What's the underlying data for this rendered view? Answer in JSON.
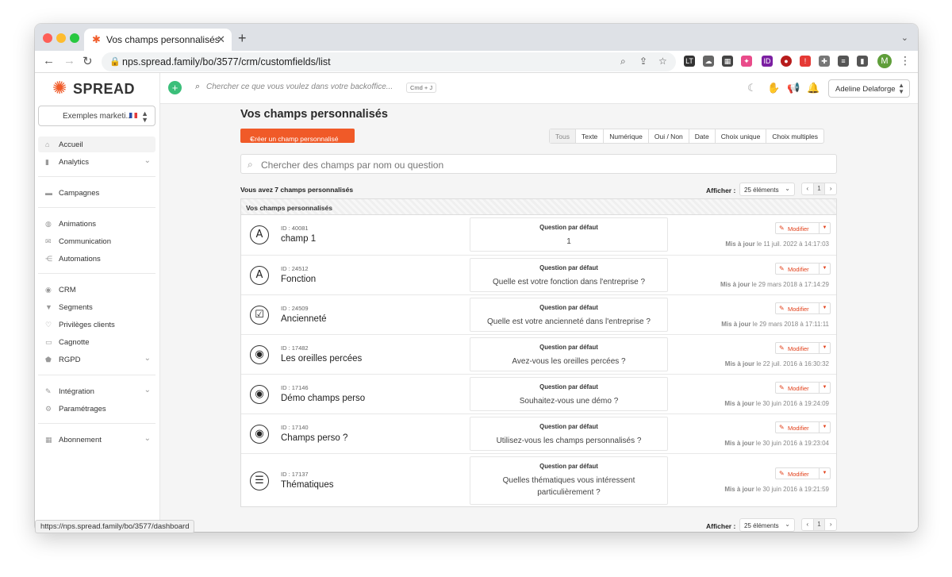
{
  "browser": {
    "tab_title": "Vos champs personnalisés",
    "url": "nps.spread.family/bo/3577/crm/customfields/list",
    "status_url": "https://nps.spread.family/bo/3577/dashboard",
    "profile_initial": "M"
  },
  "sidebar": {
    "logo_text": "SPREAD",
    "account": "Exemples marketi...",
    "items": [
      {
        "label": "Accueil"
      },
      {
        "label": "Analytics"
      },
      {
        "label": "Campagnes"
      },
      {
        "label": "Animations"
      },
      {
        "label": "Communication"
      },
      {
        "label": "Automations"
      },
      {
        "label": "CRM"
      },
      {
        "label": "Segments"
      },
      {
        "label": "Privilèges clients"
      },
      {
        "label": "Cagnotte"
      },
      {
        "label": "RGPD"
      },
      {
        "label": "Intégration"
      },
      {
        "label": "Paramétrages"
      },
      {
        "label": "Abonnement"
      }
    ]
  },
  "topbar": {
    "search_placeholder": "Chercher ce que vous voulez dans votre backoffice...",
    "shortcut": "Cmd + J",
    "user": "Adeline Delaforge"
  },
  "main": {
    "title": "Vos champs personnalisés",
    "create_button": "Créer un champ personnalisé",
    "filters": [
      "Tous",
      "Texte",
      "Numérique",
      "Oui / Non",
      "Date",
      "Choix unique",
      "Choix multiples"
    ],
    "search_placeholder": "Chercher des champs par nom ou question",
    "count_text": "Vous avez 7 champs personnalisés",
    "show_label": "Afficher :",
    "per_page": "25 éléments",
    "page": "1",
    "panel_title": "Vos champs personnalisés",
    "question_header": "Question par défaut",
    "edit_label": "Modifier",
    "updated_label": "Mis à jour",
    "rows": [
      {
        "icon": "text-icon",
        "id": "ID : 40081",
        "name": "champ 1",
        "question": "1",
        "updated": "le 11 juil. 2022 à 14:17:03"
      },
      {
        "icon": "text-icon",
        "id": "ID : 24512",
        "name": "Fonction",
        "question": "Quelle est votre fonction dans l'entreprise ?",
        "updated": "le 29 mars 2018 à 17:14:29"
      },
      {
        "icon": "checkbox-icon",
        "id": "ID : 24509",
        "name": "Ancienneté",
        "question": "Quelle est votre ancienneté dans l'entreprise ?",
        "updated": "le 29 mars 2018 à 17:11:11"
      },
      {
        "icon": "radio-icon",
        "id": "ID : 17482",
        "name": "Les oreilles percées",
        "question": "Avez-vous les oreilles percées ?",
        "updated": "le 22 juil. 2016 à 16:30:32"
      },
      {
        "icon": "radio-icon",
        "id": "ID : 17146",
        "name": "Démo champs perso",
        "question": "Souhaitez-vous une démo ?",
        "updated": "le 30 juin 2016 à 19:24:09"
      },
      {
        "icon": "radio-icon",
        "id": "ID : 17140",
        "name": "Champs perso ?",
        "question": "Utilisez-vous les champs personnalisés ?",
        "updated": "le 30 juin 2016 à 19:23:04"
      },
      {
        "icon": "list-icon",
        "id": "ID : 17137",
        "name": "Thématiques",
        "question": "Quelles thématiques vous intéressent particulièrement ?",
        "updated": "le 30 juin 2016 à 19:21:59"
      }
    ]
  }
}
